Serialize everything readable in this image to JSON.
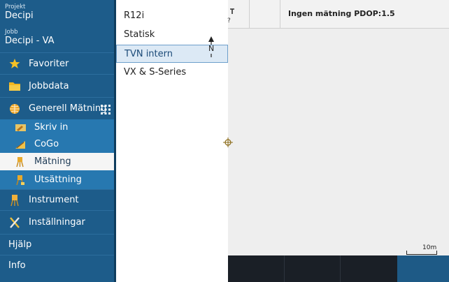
{
  "sidebar": {
    "project_label": "Projekt",
    "project_value": "Decipi",
    "job_label": "Jobb",
    "job_value": "Decipi - VA",
    "items": {
      "favorites": "Favoriter",
      "jobdata": "Jobbdata",
      "general_measure": "Generell Mätning",
      "keyin": "Skriv in",
      "cogo": "CoGo",
      "measure": "Mätning",
      "stakeout": "Utsättning",
      "instrument": "Instrument",
      "settings": "Inställningar",
      "help": "Hjälp",
      "info": "Info"
    }
  },
  "popup": {
    "items": [
      "R12i",
      "Statisk",
      "TVN intern",
      "VX & S-Series"
    ],
    "selected": "TVN intern"
  },
  "map": {
    "status_text": "Ingen mätning  PDOP:1.5",
    "status_symbol": "?",
    "compass_label": "N",
    "scale_label": "10m"
  },
  "colors": {
    "sidebar": "#1d5c8a",
    "submenu": "#2778b0",
    "selection": "#dce9f5",
    "bottombar": "#1a1f26"
  }
}
